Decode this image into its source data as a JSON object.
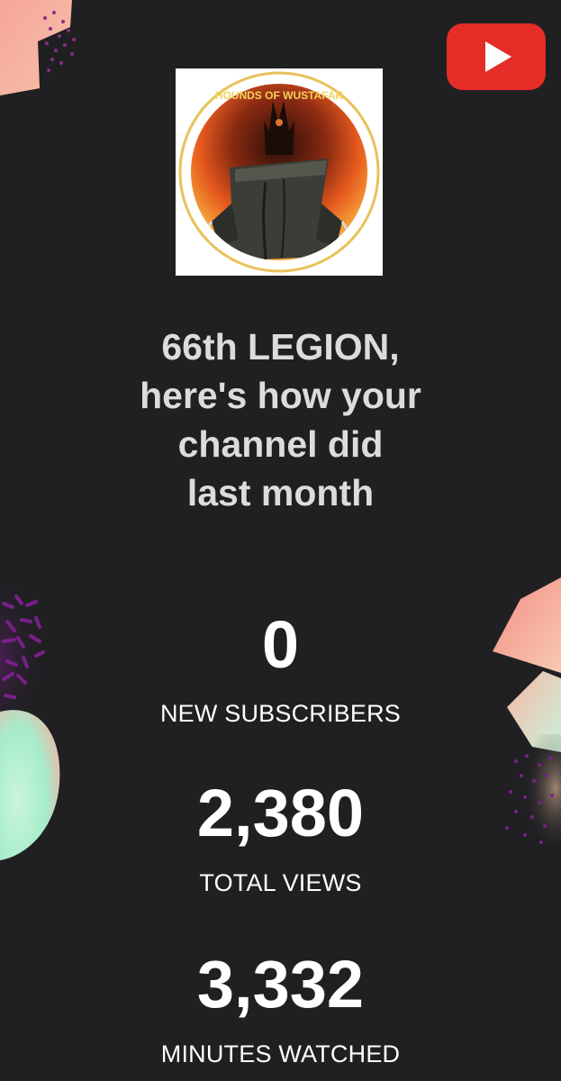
{
  "brand": {
    "logo_icon": "youtube-play-icon",
    "logo_color": "#e52d27",
    "avatar_icon": "channel-avatar-image",
    "avatar_badge_text": "HOUNDS OF WUSTAFAR"
  },
  "headline": {
    "line1": "66th LEGION,",
    "line2": "here's how your",
    "line3": "channel did",
    "line4": "last month"
  },
  "stats": [
    {
      "value": "0",
      "label": "NEW SUBSCRIBERS"
    },
    {
      "value": "2,380",
      "label": "TOTAL VIEWS"
    },
    {
      "value": "3,332",
      "label": "MINUTES WATCHED"
    }
  ],
  "colors": {
    "background": "#202023",
    "headline_text": "#dcdcdc",
    "stat_text": "#ffffff",
    "accent_pink": "#f0857a",
    "accent_mint": "#bff2dc",
    "accent_purple": "#7a1f8a"
  }
}
